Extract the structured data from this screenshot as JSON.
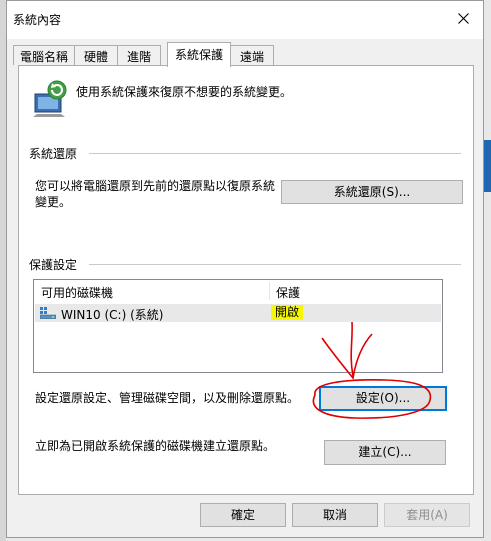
{
  "window": {
    "title": "系統內容"
  },
  "tabs": [
    {
      "label": "電腦名稱",
      "active": false
    },
    {
      "label": "硬體",
      "active": false
    },
    {
      "label": "進階",
      "active": false
    },
    {
      "label": "系統保護",
      "active": true
    },
    {
      "label": "遠端",
      "active": false
    }
  ],
  "intro": {
    "text": "使用系統保護來復原不想要的系統變更。"
  },
  "system_restore": {
    "heading": "系統還原",
    "description_line1": "您可以將電腦還原到先前的還原點以復原系統",
    "description_line2": "變更。",
    "button_label": "系統還原(S)..."
  },
  "protection": {
    "heading": "保護設定",
    "columns": [
      "可用的磁碟機",
      "保護"
    ],
    "drives": [
      {
        "name": "WIN10 (C:) (系統)",
        "status": "開啟"
      }
    ],
    "configure_text": "設定還原設定、管理磁碟空間，以及刪除還原點。",
    "configure_button": "設定(O)...",
    "create_text": "立即為已開啟系統保護的磁碟機建立還原點。",
    "create_button": "建立(C)..."
  },
  "footer": {
    "ok_label": "確定",
    "cancel_label": "取消",
    "apply_label": "套用(A)"
  },
  "colors": {
    "highlight_yellow": "#f7f700",
    "focus_blue": "#0078d7",
    "annotation_red": "#e00000"
  }
}
